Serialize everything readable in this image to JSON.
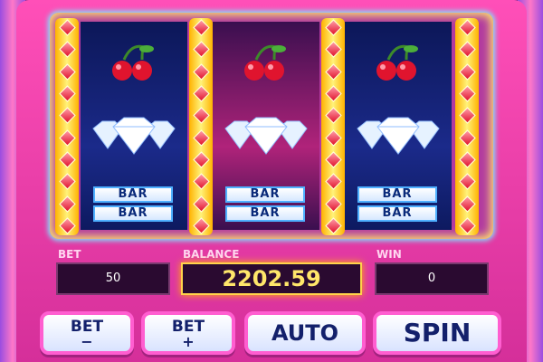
{
  "reels": [
    {
      "cherry": "cherry-pair",
      "diamond": "diamond-cluster",
      "bars": [
        "BAR",
        "BAR"
      ]
    },
    {
      "cherry": "cherry-pair",
      "diamond": "diamond-cluster",
      "bars": [
        "BAR",
        "BAR"
      ]
    },
    {
      "cherry": "cherry-pair",
      "diamond": "diamond-cluster",
      "bars": [
        "BAR",
        "BAR"
      ]
    }
  ],
  "panel": {
    "bet_label": "BET",
    "bet_value": "50",
    "balance_label": "BALANCE",
    "balance_value": "2202.59",
    "win_label": "WIN",
    "win_value": "0"
  },
  "buttons": {
    "bet_minus_top": "BET",
    "bet_minus_bottom": "−",
    "bet_plus_top": "BET",
    "bet_plus_bottom": "+",
    "auto": "AUTO",
    "spin": "SPIN"
  },
  "colors": {
    "frame": "#ff4fb8",
    "reel_blue": "#1b2a8a",
    "reel_pink": "#b0237a",
    "balance": "#ffe66a",
    "gem": "#e0142e"
  }
}
